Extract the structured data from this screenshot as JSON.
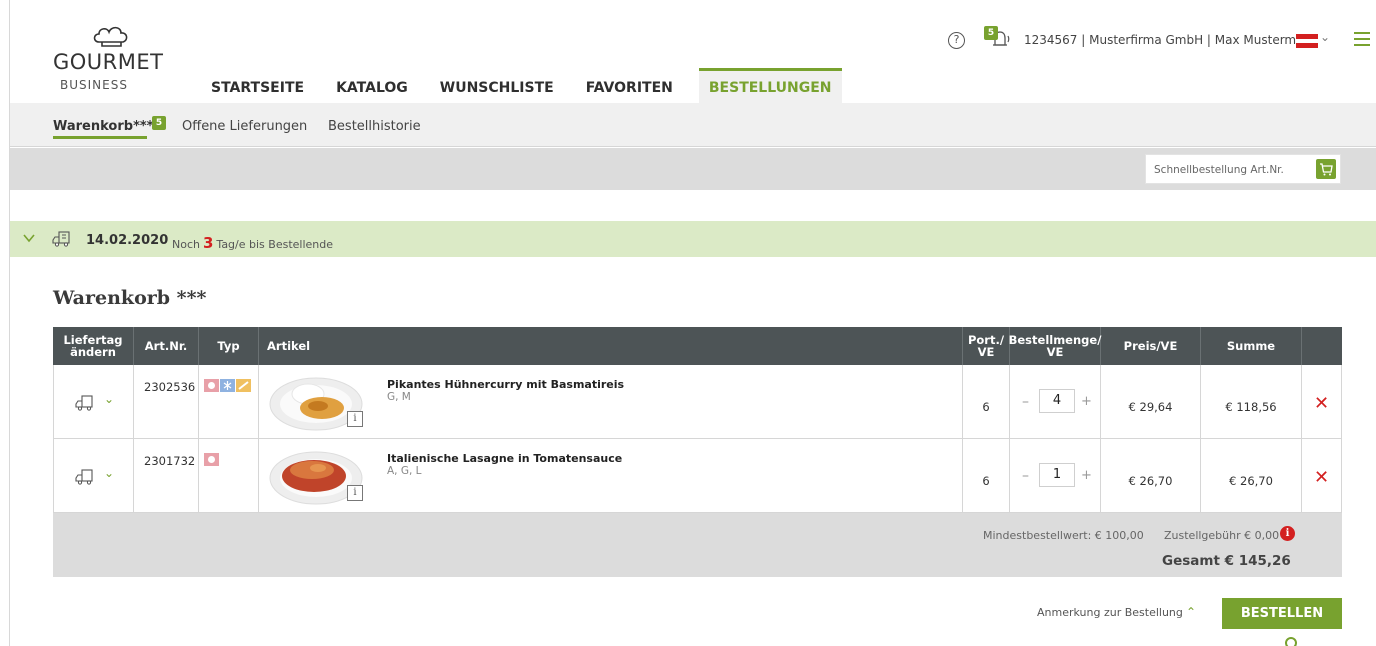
{
  "brand": {
    "word": "GOURMET",
    "sub": "BUSINESS"
  },
  "nav": [
    "STARTSEITE",
    "KATALOG",
    "WUNSCHLISTE",
    "FAVORITEN",
    "BESTELLUNGEN"
  ],
  "topbar": {
    "help": "?",
    "notifications": "5",
    "user": "1234567 | Musterfirma GmbH | Max Mustermann"
  },
  "subnav": {
    "cart": "Warenkorb***",
    "cart_badge": "5",
    "open": "Offene Lieferungen",
    "history": "Bestellhistorie"
  },
  "quick": {
    "placeholder": "Schnellbestellung Art.Nr."
  },
  "delivery": {
    "date": "14.02.2020",
    "prefix": "Noch",
    "days": "3",
    "suffix": "Tag/e bis Bestellende"
  },
  "cart_title": "Warenkorb ***",
  "table": {
    "headers": {
      "change_day_1": "Liefertag",
      "change_day_2": "ändern",
      "artnr": "Art.Nr.",
      "type": "Typ",
      "article": "Artikel",
      "port_1": "Port./",
      "port_2": "VE",
      "qty_1": "Bestellmenge/",
      "qty_2": "VE",
      "price": "Preis/VE",
      "sum": "Summe"
    },
    "rows": [
      {
        "artnr": "2302536",
        "name": "Pikantes Hühnercurry mit Basmatireis",
        "allergens": "G, M",
        "port": "6",
        "qty": "4",
        "price": "€ 29,64",
        "sum": "€ 118,56"
      },
      {
        "artnr": "2301732",
        "name": "Italienische Lasagne in Tomatensauce",
        "allergens": "A, G, L",
        "port": "6",
        "qty": "1",
        "price": "€ 26,70",
        "sum": "€ 26,70"
      }
    ]
  },
  "summary": {
    "min_order": "Mindestbestellwert: € 100,00",
    "delivery_fee": "Zustellgebühr € 0,00",
    "total": "Gesamt € 145,26"
  },
  "footer": {
    "note": "Anmerkung zur Bestellung",
    "order_button": "BESTELLEN"
  },
  "colors": {
    "accent": "#78a22f",
    "header_dark": "#4d5456",
    "danger": "#d32020",
    "date_bar": "#dbeac6"
  },
  "icons": {
    "help": "help-circle-icon",
    "bell": "bell-icon",
    "flag": "austria-flag-icon",
    "menu": "hamburger-menu-icon",
    "cart": "cart-icon",
    "truck": "delivery-truck-icon",
    "remove": "close-x-icon",
    "info": "info-icon"
  }
}
